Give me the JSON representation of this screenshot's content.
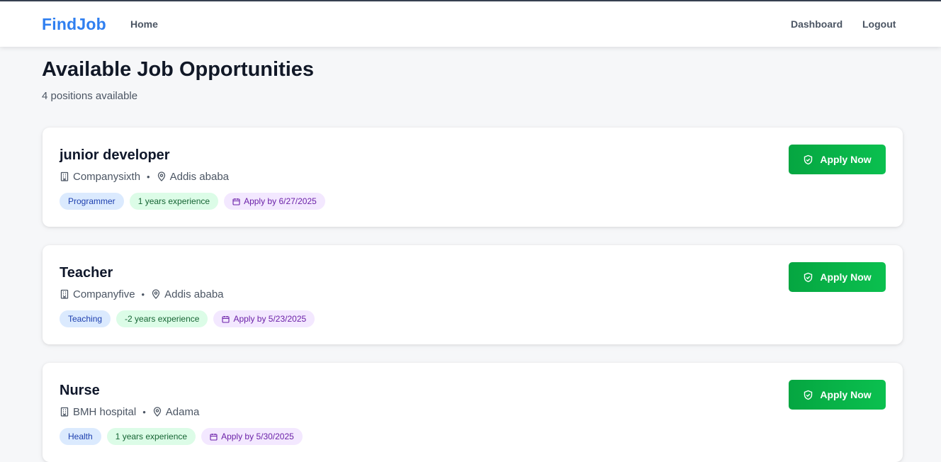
{
  "navbar": {
    "brand": "FindJob",
    "links": {
      "home": "Home",
      "dashboard": "Dashboard",
      "logout": "Logout"
    }
  },
  "header": {
    "title": "Available Job Opportunities",
    "subtitle": "4 positions available"
  },
  "jobs": [
    {
      "title": "junior developer",
      "company": "Companysixth",
      "location": "Addis ababa",
      "category": "Programmer",
      "experience": "1 years experience",
      "deadline": "Apply by 6/27/2025",
      "apply_label": "Apply Now"
    },
    {
      "title": "Teacher",
      "company": "Companyfive",
      "location": "Addis ababa",
      "category": "Teaching",
      "experience": "-2 years experience",
      "deadline": "Apply by 5/23/2025",
      "apply_label": "Apply Now"
    },
    {
      "title": "Nurse",
      "company": "BMH hospital",
      "location": "Adama",
      "category": "Health",
      "experience": "1 years experience",
      "deadline": "Apply by 5/30/2025",
      "apply_label": "Apply Now"
    }
  ],
  "meta_separator": "•",
  "icons": {
    "company": "building-icon",
    "location": "map-pin-icon",
    "deadline": "calendar-icon",
    "apply": "shield-check-icon"
  },
  "colors": {
    "brand": "#2f7ff0",
    "apply_button": "#05a641",
    "category_tag_bg": "#dbeafe",
    "experience_tag_bg": "#dcfce7",
    "deadline_tag_bg": "#f3e8ff"
  }
}
